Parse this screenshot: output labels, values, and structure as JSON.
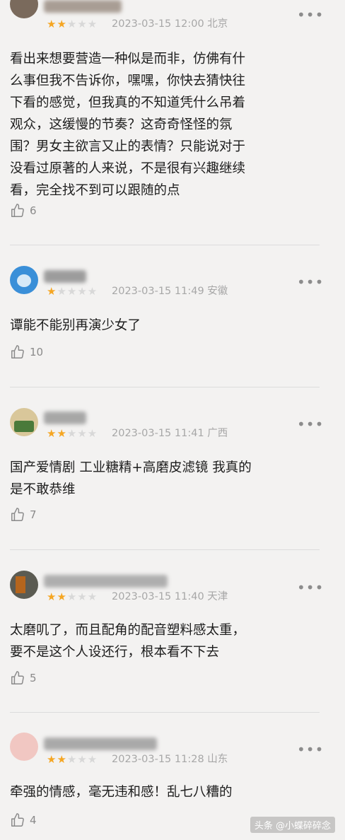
{
  "reviews": [
    {
      "rating": 2,
      "date": "2023-03-15 12:00",
      "location": "北京",
      "content": "看出来想要营造一种似是而非，仿佛有什\n么事但我不告诉你，嘿嘿，你快去猜快往\n下看的感觉，但我真的不知道凭什么吊着\n观众，这缓慢的节奏？这奇奇怪怪的氛\n围？男女主欲言又止的表情？只能说对于\n没看过原著的人来说，不是很有兴趣继续\n看，完全找不到可以跟随的点",
      "likes": "6",
      "avatar_color": "#7a6a5c"
    },
    {
      "rating": 1,
      "date": "2023-03-15 11:49",
      "location": "安徽",
      "content": "谭能不能别再演少女了",
      "likes": "10",
      "avatar_color": "#3a8fd8"
    },
    {
      "rating": 2,
      "date": "2023-03-15 11:41",
      "location": "广西",
      "content": "国产爱情剧 工业糖精+高磨皮滤镜 我真的\n是不敢恭维",
      "likes": "7",
      "avatar_color": "#c9b07a"
    },
    {
      "rating": 2,
      "date": "2023-03-15 11:40",
      "location": "天津",
      "content": "太磨叽了，而且配角的配音塑料感太重，\n要不是这个人设还行，根本看不下去",
      "likes": "5",
      "avatar_color": "#5b5b52"
    },
    {
      "rating": 2,
      "date": "2023-03-15 11:28",
      "location": "山东",
      "content": "牵强的情感，毫无违和感！乱七八糟的",
      "likes": "4",
      "avatar_color": "#e8a9a3"
    }
  ],
  "more_label": "•••",
  "star_glyph": "★",
  "watermark": "头条 @小蝶碎碎念"
}
